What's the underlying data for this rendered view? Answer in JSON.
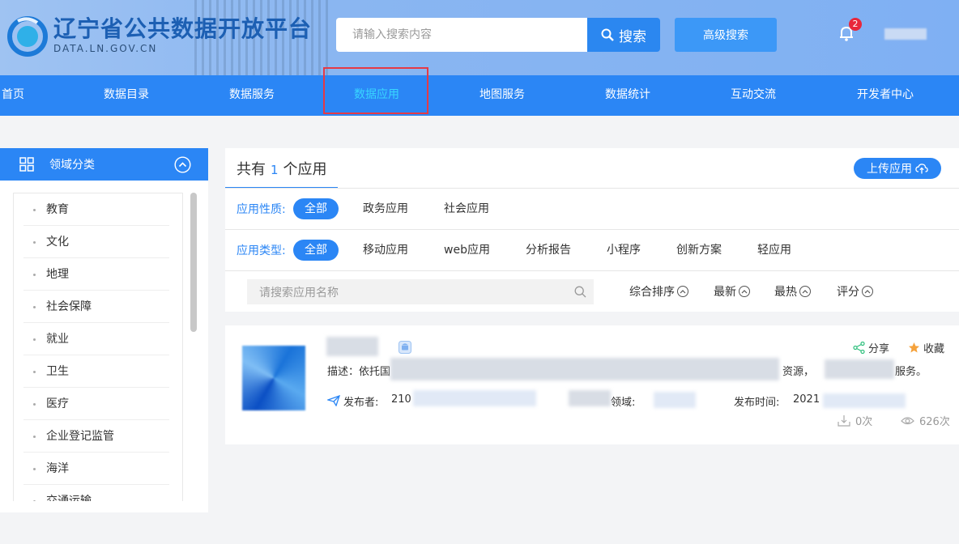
{
  "header": {
    "logo_title": "辽宁省公共数据开放平台",
    "logo_sub": "DATA.LN.GOV.CN",
    "search_placeholder": "请输入搜索内容",
    "search_button": "搜索",
    "advanced_search": "高级搜索",
    "notification_count": "2"
  },
  "nav": {
    "items": [
      "首页",
      "数据目录",
      "数据服务",
      "数据应用",
      "地图服务",
      "数据统计",
      "互动交流",
      "开发者中心"
    ],
    "active_index": 3
  },
  "sidebar": {
    "title": "领域分类",
    "items": [
      "教育",
      "文化",
      "地理",
      "社会保障",
      "就业",
      "卫生",
      "医疗",
      "企业登记监管",
      "海洋",
      "交通运输"
    ]
  },
  "main": {
    "count_prefix": "共有",
    "count": "1",
    "count_suffix": "个应用",
    "upload_button": "上传应用",
    "nature": {
      "label": "应用性质:",
      "options": [
        "全部",
        "政务应用",
        "社会应用"
      ]
    },
    "type": {
      "label": "应用类型:",
      "options": [
        "全部",
        "移动应用",
        "web应用",
        "分析报告",
        "小程序",
        "创新方案",
        "轻应用"
      ]
    },
    "search_placeholder": "请搜索应用名称",
    "sort_options": [
      "综合排序",
      "最新",
      "最热",
      "评分"
    ]
  },
  "app": {
    "desc_prefix": "描述：依托国",
    "desc_mid": "资源，",
    "desc_suffix": "服务。",
    "publisher_label": "发布者:",
    "publisher_value": "210",
    "domain_label": "领域:",
    "time_label": "发布时间:",
    "time_value": "2021",
    "share": "分享",
    "favorite": "收藏",
    "downloads": "0次",
    "views": "626次"
  },
  "colors": {
    "primary": "#2b86f5",
    "highlight_box": "#e53a45",
    "active_nav_text": "#38d6ff",
    "badge": "#e8273b"
  }
}
